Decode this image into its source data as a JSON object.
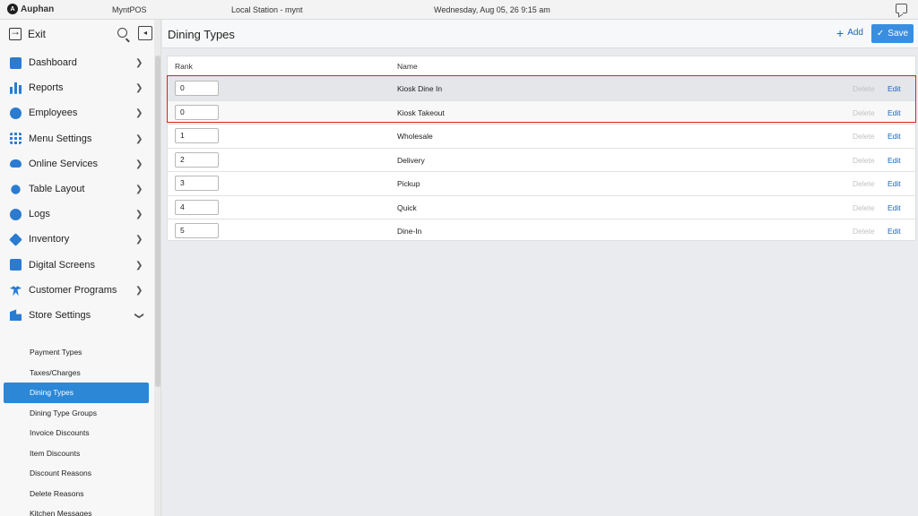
{
  "topbar": {
    "brand": "Auphan",
    "app": "MyntPOS",
    "station": "Local Station - mynt",
    "datetime": "Wednesday, Aug 05, 26 9:15 am"
  },
  "sidebar": {
    "exit_label": "Exit",
    "items": [
      {
        "label": "Dashboard",
        "icon": "dashboard-icon"
      },
      {
        "label": "Reports",
        "icon": "bar-chart-icon"
      },
      {
        "label": "Employees",
        "icon": "employees-icon"
      },
      {
        "label": "Menu Settings",
        "icon": "grid-icon"
      },
      {
        "label": "Online Services",
        "icon": "cloud-icon"
      },
      {
        "label": "Table Layout",
        "icon": "table-layout-icon"
      },
      {
        "label": "Logs",
        "icon": "logs-search-icon"
      },
      {
        "label": "Inventory",
        "icon": "cube-icon"
      },
      {
        "label": "Digital Screens",
        "icon": "image-icon"
      },
      {
        "label": "Customer Programs",
        "icon": "person-icon"
      },
      {
        "label": "Store Settings",
        "icon": "building-icon"
      }
    ],
    "store_settings_sub": [
      "Payment Types",
      "Taxes/Charges",
      "Dining Types",
      "Dining Type Groups",
      "Invoice Discounts",
      "Item Discounts",
      "Discount Reasons",
      "Delete Reasons",
      "Kitchen Messages"
    ],
    "active_sub": "Dining Types"
  },
  "main": {
    "title": "Dining Types",
    "add_label": "Add",
    "save_label": "Save",
    "columns": {
      "rank": "Rank",
      "name": "Name"
    },
    "rows": [
      {
        "rank": "0",
        "name": "Kiosk Dine In",
        "delete": "Delete",
        "edit": "Edit"
      },
      {
        "rank": "0",
        "name": "Kiosk Takeout",
        "delete": "Delete",
        "edit": "Edit"
      },
      {
        "rank": "1",
        "name": "Wholesale",
        "delete": "Delete",
        "edit": "Edit"
      },
      {
        "rank": "2",
        "name": "Delivery",
        "delete": "Delete",
        "edit": "Edit"
      },
      {
        "rank": "3",
        "name": "Pickup",
        "delete": "Delete",
        "edit": "Edit"
      },
      {
        "rank": "4",
        "name": "Quick",
        "delete": "Delete",
        "edit": "Edit"
      },
      {
        "rank": "5",
        "name": "Dine-In",
        "delete": "Delete",
        "edit": "Edit"
      }
    ]
  },
  "colors": {
    "accent": "#3a8ee0",
    "active_item": "#2c87d6",
    "highlight_border": "#e02020",
    "link": "#2066b8"
  }
}
